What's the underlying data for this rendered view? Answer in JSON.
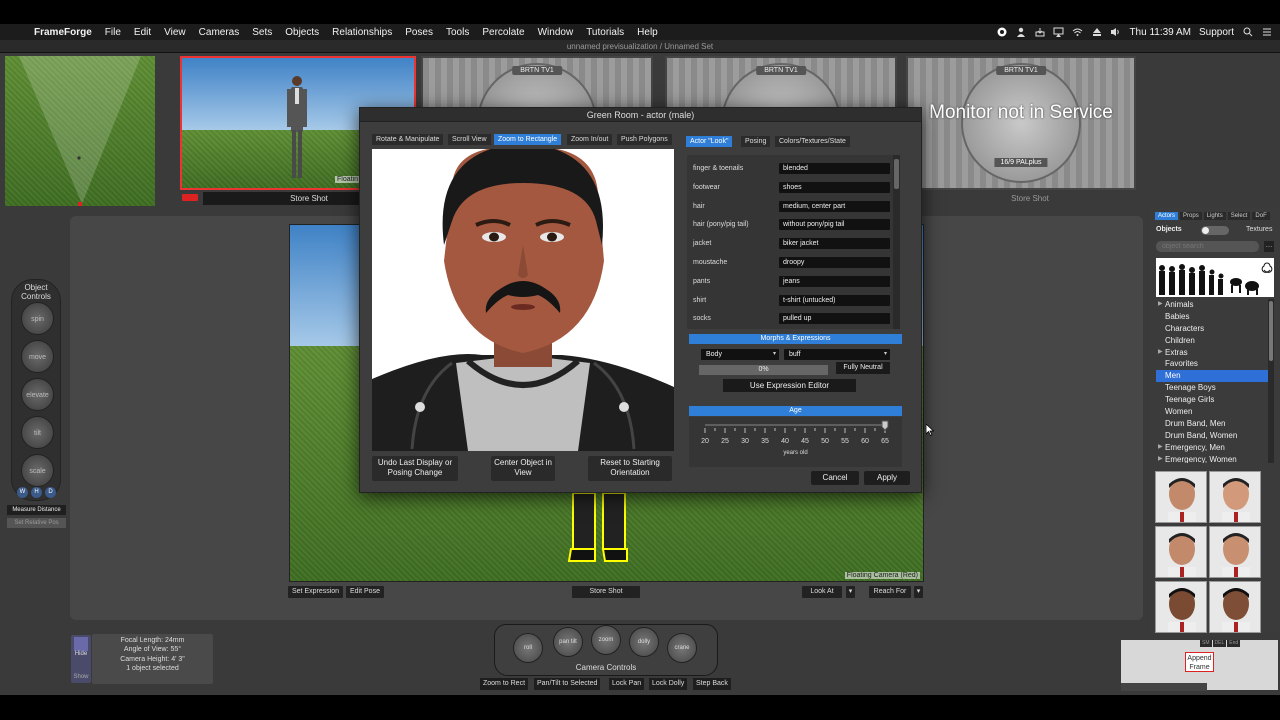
{
  "menubar": {
    "app_name": "FrameForge",
    "items": [
      "File",
      "Edit",
      "View",
      "Cameras",
      "Sets",
      "Objects",
      "Relationships",
      "Poses",
      "Tools",
      "Percolate",
      "Window",
      "Tutorials",
      "Help"
    ],
    "clock": "Thu 11:39 AM",
    "support": "Support"
  },
  "window_title": "unnamed previsualization / Unnamed Set",
  "monitors": {
    "floating_label": "Floatin",
    "store_shot_1": "Store Shot",
    "store_shot_2": "Store Shot",
    "testcard_brand": "BRTN TV1",
    "not_in_service": "Monitor not in Service",
    "pal": "16/9 PALplus"
  },
  "main_view": {
    "camera_label": "Floating Camera (Red)",
    "set_expression": "Set Expression",
    "edit_pose": "Edit Pose",
    "store_shot": "Store Shot",
    "look_at": "Look At",
    "reach_for": "Reach For"
  },
  "object_controls": {
    "title": "Object Controls",
    "knobs": [
      "spin",
      "move",
      "elevate",
      "tilt",
      "scale"
    ],
    "whd": [
      "W",
      "H",
      "D"
    ],
    "measure_distance": "Measure Distance",
    "set_relative_pos": "Set Relative Pos"
  },
  "camera_info": {
    "hide": "Hide",
    "show": "Show",
    "lines": [
      "Focal Length: 24mm",
      "Angle of View: 55°",
      "Camera Height: 4' 3\"",
      "1 object selected"
    ]
  },
  "camera_controls": {
    "label": "Camera Controls",
    "knobs": [
      "roll",
      "pan tilt",
      "zoom",
      "dolly",
      "crane"
    ],
    "buttons": [
      "Zoom to Rect",
      "Pan/Tilt to Selected",
      "Lock Pan",
      "Lock Dolly",
      "Step Back"
    ]
  },
  "library": {
    "tabs": [
      "Actors",
      "Props",
      "Lights",
      "Select",
      "DoF"
    ],
    "objects_label": "Objects",
    "textures_label": "Textures",
    "search_placeholder": "object search",
    "categories": [
      {
        "label": "Animals",
        "expandable": true
      },
      {
        "label": "Babies",
        "expandable": false
      },
      {
        "label": "Characters",
        "expandable": false
      },
      {
        "label": "Children",
        "expandable": false
      },
      {
        "label": "Extras",
        "expandable": true
      },
      {
        "label": "Favorites",
        "expandable": false
      },
      {
        "label": "Men",
        "expandable": false,
        "selected": true
      },
      {
        "label": "Teenage Boys",
        "expandable": false
      },
      {
        "label": "Teenage Girls",
        "expandable": false
      },
      {
        "label": "Women",
        "expandable": false
      },
      {
        "label": "Drum Band, Men",
        "expandable": false
      },
      {
        "label": "Drum Band, Women",
        "expandable": false
      },
      {
        "label": "Emergency, Men",
        "expandable": true
      },
      {
        "label": "Emergency, Women",
        "expandable": true
      }
    ],
    "mini_buttons": [
      "SM",
      "DEL",
      "End"
    ],
    "append_frame": "Append Frame"
  },
  "green_room": {
    "title": "Green Room - actor (male)",
    "view_tabs": [
      "Rotate & Manipulate",
      "Scroll View",
      "Zoom to Rectangle",
      "Zoom In/out",
      "Push Polygons"
    ],
    "selected_view_tab": "Zoom to Rectangle",
    "prop_tabs": [
      "Actor \"Look\"",
      "Posing",
      "Colors/Textures/State"
    ],
    "selected_prop_tab": "Actor \"Look\"",
    "properties": [
      {
        "label": "finger & toenails",
        "value": "blended"
      },
      {
        "label": "footwear",
        "value": "shoes"
      },
      {
        "label": "hair",
        "value": "medium, center part"
      },
      {
        "label": "hair (pony/pig tail)",
        "value": "without pony/pig tail"
      },
      {
        "label": "jacket",
        "value": "biker jacket"
      },
      {
        "label": "moustache",
        "value": "droopy"
      },
      {
        "label": "pants",
        "value": "jeans"
      },
      {
        "label": "shirt",
        "value": "t-shirt (untucked)"
      },
      {
        "label": "socks",
        "value": "pulled up"
      }
    ],
    "morphs_title": "Morphs & Expressions",
    "morph_region": "Body",
    "morph_type": "buff",
    "morph_amount": "0%",
    "fully_neutral": "Fully Neutral",
    "expression_editor": "Use Expression Editor",
    "age_title": "Age",
    "age_ticks": [
      "20",
      "25",
      "30",
      "35",
      "40",
      "45",
      "50",
      "55",
      "60",
      "65"
    ],
    "age_value": 65,
    "age_min": 20,
    "age_max": 65,
    "years_old": "years old",
    "undo_btn": "Undo Last Display or Posing Change",
    "center_btn": "Center Object in View",
    "reset_btn": "Reset to Starting Orientation",
    "cancel": "Cancel",
    "apply": "Apply"
  },
  "colors": {
    "accent": "#2f7fd8",
    "selection_red": "#dd2222"
  }
}
